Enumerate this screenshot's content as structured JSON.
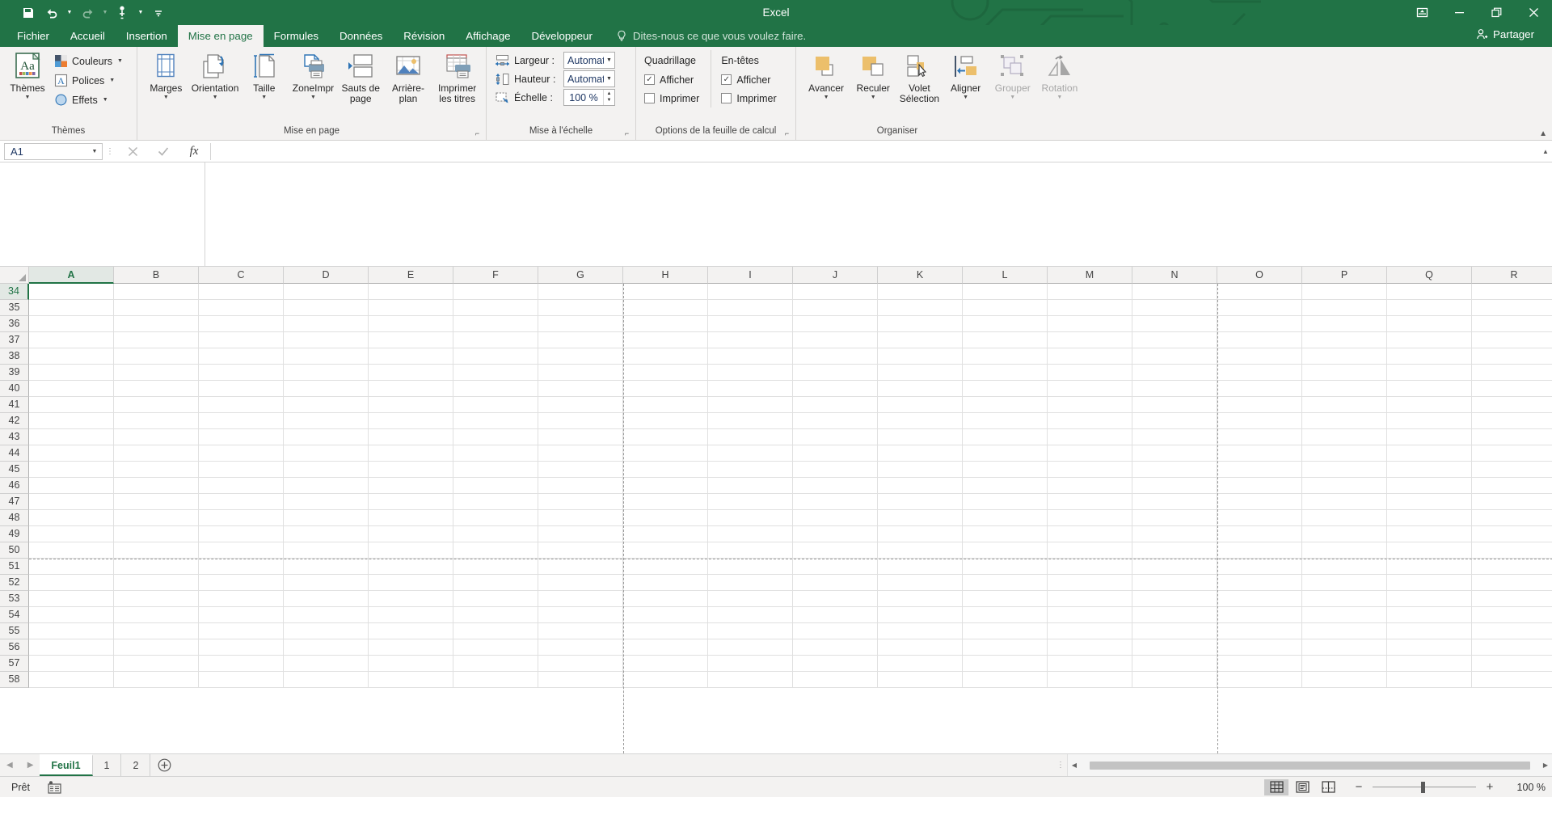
{
  "titlebar": {
    "app_title": "Excel",
    "qat": [
      {
        "name": "save-button",
        "icon": "save-icon"
      },
      {
        "name": "undo-button",
        "icon": "undo-icon"
      },
      {
        "name": "redo-button",
        "icon": "redo-icon"
      },
      {
        "name": "touch-mode-button",
        "icon": "touch-mode-icon"
      },
      {
        "name": "customize-qat-button",
        "icon": "chevron-down-icon"
      }
    ],
    "window": {
      "ribbon_display_options": "ribbon-display-icon",
      "minimize": "minimize-icon",
      "restore": "restore-icon",
      "close": "close-icon"
    }
  },
  "tabs": [
    {
      "label": "Fichier",
      "active": false
    },
    {
      "label": "Accueil",
      "active": false
    },
    {
      "label": "Insertion",
      "active": false
    },
    {
      "label": "Mise en page",
      "active": true
    },
    {
      "label": "Formules",
      "active": false
    },
    {
      "label": "Données",
      "active": false
    },
    {
      "label": "Révision",
      "active": false
    },
    {
      "label": "Affichage",
      "active": false
    },
    {
      "label": "Développeur",
      "active": false
    }
  ],
  "tell_me": "Dites-nous ce que vous voulez faire.",
  "share_label": "Partager",
  "ribbon": {
    "groups": [
      {
        "label": "Thèmes",
        "has_launcher": false,
        "big_buttons": [
          {
            "label": "Thèmes",
            "icon": "themes-icon",
            "has_dropdown": true
          }
        ],
        "small_buttons": [
          {
            "label": "Couleurs",
            "icon": "colors-icon",
            "has_dropdown": true
          },
          {
            "label": "Polices",
            "icon": "fonts-icon",
            "has_dropdown": true
          },
          {
            "label": "Effets",
            "icon": "effects-icon",
            "has_dropdown": true
          }
        ]
      },
      {
        "label": "Mise en page",
        "has_launcher": true,
        "big_buttons": [
          {
            "label": "Marges",
            "icon": "margins-icon",
            "has_dropdown": true
          },
          {
            "label": "Orientation",
            "icon": "orientation-icon",
            "has_dropdown": true
          },
          {
            "label": "Taille",
            "icon": "size-icon",
            "has_dropdown": true
          },
          {
            "label": "ZoneImpr",
            "icon": "print-area-icon",
            "has_dropdown": true
          },
          {
            "label": "Sauts de page",
            "icon": "page-breaks-icon",
            "has_dropdown": true
          },
          {
            "label": "Arrière-plan",
            "icon": "background-icon",
            "has_dropdown": false
          },
          {
            "label": "Imprimer les titres",
            "icon": "print-titles-icon",
            "has_dropdown": false
          }
        ]
      },
      {
        "label": "Mise à l'échelle",
        "has_launcher": true,
        "fields": [
          {
            "label": "Largeur :",
            "value": "Automatique",
            "type": "combo",
            "name": "width-combo"
          },
          {
            "label": "Hauteur :",
            "value": "Automatique",
            "type": "combo",
            "name": "height-combo"
          },
          {
            "label": "Échelle :",
            "value": "100 %",
            "type": "spinner",
            "name": "scale-spinner"
          }
        ]
      },
      {
        "label": "Options de la feuille de calcul",
        "has_launcher": true,
        "columns": [
          {
            "header": "Quadrillage",
            "items": [
              {
                "label": "Afficher",
                "checked": true,
                "name": "gridlines-view-checkbox"
              },
              {
                "label": "Imprimer",
                "checked": false,
                "name": "gridlines-print-checkbox"
              }
            ]
          },
          {
            "header": "En-têtes",
            "items": [
              {
                "label": "Afficher",
                "checked": true,
                "name": "headings-view-checkbox"
              },
              {
                "label": "Imprimer",
                "checked": false,
                "name": "headings-print-checkbox"
              }
            ]
          }
        ]
      },
      {
        "label": "Organiser",
        "has_launcher": false,
        "big_buttons": [
          {
            "label": "Avancer",
            "icon": "bring-forward-icon",
            "has_dropdown": true,
            "disabled": false
          },
          {
            "label": "Reculer",
            "icon": "send-backward-icon",
            "has_dropdown": true,
            "disabled": false
          },
          {
            "label": "Volet Sélection",
            "icon": "selection-pane-icon",
            "has_dropdown": false,
            "disabled": false
          },
          {
            "label": "Aligner",
            "icon": "align-icon",
            "has_dropdown": true,
            "disabled": false
          },
          {
            "label": "Grouper",
            "icon": "group-icon",
            "has_dropdown": true,
            "disabled": true
          },
          {
            "label": "Rotation",
            "icon": "rotate-icon",
            "has_dropdown": true,
            "disabled": true
          }
        ]
      }
    ],
    "collapse_icon": "chevron-up-icon"
  },
  "formula_bar": {
    "name_box_value": "A1",
    "name_box_dropdown": "chevron-down-icon",
    "cancel_icon": "close-icon",
    "enter_icon": "check-icon",
    "function_icon": "fx-icon",
    "formula_value": "",
    "expand_icon": "chevron-down-icon"
  },
  "grid": {
    "columns": [
      "A",
      "B",
      "C",
      "D",
      "E",
      "F",
      "G",
      "H",
      "I",
      "J",
      "K",
      "L",
      "M",
      "N",
      "O",
      "P",
      "Q",
      "R"
    ],
    "selected_column": "A",
    "rows": [
      34,
      35,
      36,
      37,
      38,
      39,
      40,
      41,
      42,
      43,
      44,
      45,
      46,
      47,
      48,
      49,
      50,
      51,
      52,
      53,
      54,
      55,
      56,
      57,
      58
    ],
    "selected_row": 34,
    "page_break_columns": [
      "G",
      "N"
    ],
    "page_break_after_row": 50
  },
  "sheet_tabs": {
    "prev_icon": "triangle-left-icon",
    "next_icon": "triangle-right-icon",
    "tabs": [
      {
        "label": "Feuil1",
        "active": true
      },
      {
        "label": "1",
        "active": false
      },
      {
        "label": "2",
        "active": false
      }
    ],
    "add_label": "+"
  },
  "status_bar": {
    "status": "Prêt",
    "accessibility_icon": "accessibility-icon",
    "views": [
      {
        "name": "normal-view-button",
        "icon": "grid-view-icon",
        "active": true
      },
      {
        "name": "page-layout-view-button",
        "icon": "page-layout-icon",
        "active": false
      },
      {
        "name": "page-break-preview-button",
        "icon": "page-break-preview-icon",
        "active": false
      }
    ],
    "zoom_out": "−",
    "zoom_in": "+",
    "zoom_level": "100 %"
  },
  "colors": {
    "brand_green": "#217346",
    "ribbon_bg": "#f3f2f1",
    "accent_gold": "#ecbf6b",
    "grid_line": "#e0e0e0"
  }
}
